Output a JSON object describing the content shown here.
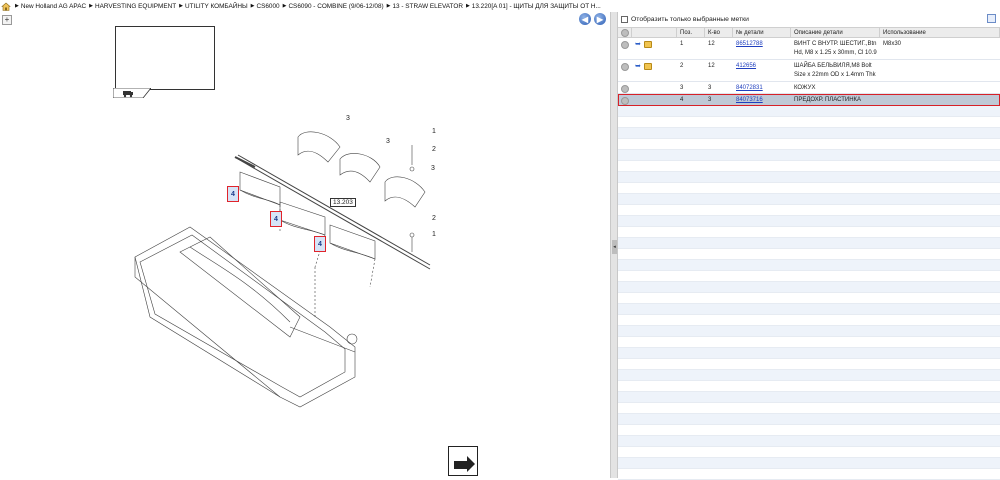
{
  "breadcrumb": {
    "items": [
      "New Holland AG APAC",
      "HARVESTING EQUIPMENT",
      "UTILITY КОМБАЙНЫ",
      "CS6000",
      "CS6090 - COMBINE (9/06-12/08)",
      "13 - STRAW ELEVATOR",
      "13.220[A 01] - ЩИТЫ ДЛЯ ЗАЩИТЫ ОТ Н..."
    ]
  },
  "drawing": {
    "zoom_label": "+",
    "callouts": [
      "4",
      "4",
      "4"
    ],
    "reference": "13.203",
    "labels": [
      "3",
      "3",
      "3",
      "1",
      "2",
      "2",
      "1"
    ]
  },
  "parts_panel": {
    "filter_label": "Отобразить только выбранные метки",
    "columns": [
      "",
      "Поз.",
      "К-во",
      "№ детали",
      "Описание детали",
      "Использование"
    ],
    "rows": [
      {
        "pos": "1",
        "qty": "12",
        "part_no": "86512788",
        "desc": "ВИНТ С ВНУТР. ШЕСТИГ.,Btn Hd, M8 x 1.25 x 30mm, Cl 10.9",
        "usage": "M8x30",
        "icons": true,
        "selected": false
      },
      {
        "pos": "2",
        "qty": "12",
        "part_no": "412656",
        "desc": "ШАЙБА БЕЛЬВИЛЯ,M8 Bolt Size x 22mm OD x 1.4mm Thk",
        "usage": "",
        "icons": true,
        "selected": false
      },
      {
        "pos": "3",
        "qty": "3",
        "part_no": "84072831",
        "desc": "КОЖУХ",
        "usage": "",
        "icons": false,
        "selected": false
      },
      {
        "pos": "4",
        "qty": "3",
        "part_no": "84073716",
        "desc": "ПРЕДОХР. ПЛАСТИНКА",
        "usage": "",
        "icons": false,
        "selected": true
      }
    ]
  },
  "colors": {
    "highlight": "#d72028",
    "link": "#1f3fbf",
    "selected_row": "#bfc9d6"
  }
}
